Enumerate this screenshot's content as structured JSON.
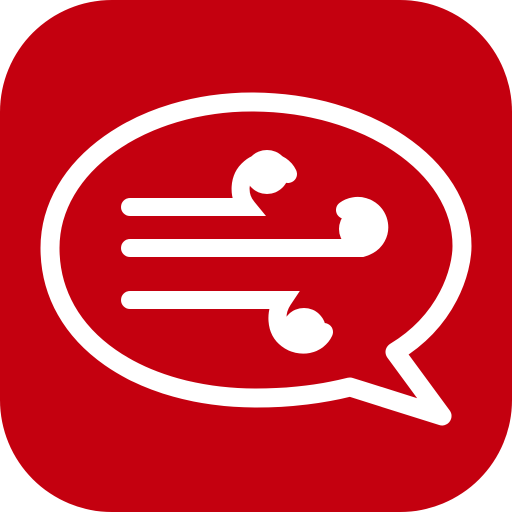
{
  "icon": {
    "name": "chat-bubble-wind-icon",
    "background_color": "#c4000f",
    "foreground_color": "#ffffff",
    "page_background": "#ffffff"
  }
}
